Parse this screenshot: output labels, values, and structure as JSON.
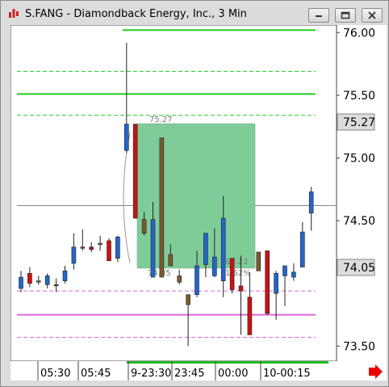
{
  "window": {
    "title": "S.FANG - Diamondback Energy, Inc., 3 Min",
    "buttons": [
      "minimize",
      "restore",
      "close"
    ]
  },
  "colors": {
    "up": "#2266cc",
    "down": "#cc1111",
    "neutral": "#7a5a30",
    "green_line": "#22cc22",
    "pink_line": "#dd66dd",
    "box_fill": "#80cc99",
    "x_axis_bar": "#22bb22",
    "arrow": "#ee0000"
  },
  "price_labels": {
    "current": "75.27",
    "last": "74.05"
  },
  "box_labels": {
    "top": "75.27",
    "bottom": "74.05",
    "amount": "$1.22",
    "percent": "1.62%"
  },
  "chart_data": {
    "type": "candlestick",
    "title": "S.FANG - Diamondback Energy, Inc., 3 Min",
    "y_ticks": [
      "76.00",
      "75.50",
      "75.00",
      "74.50",
      "73.50"
    ],
    "y_tick_values": [
      76.0,
      75.5,
      75.0,
      74.5,
      73.5
    ],
    "ylim": [
      73.38,
      76.06
    ],
    "x_ticks": [
      "05:30",
      "05:45",
      "9-23:30",
      "23:45",
      "00:00",
      "10-00:15"
    ],
    "candles": [
      {
        "o": 74.05,
        "h": 74.1,
        "l": 73.93,
        "c": 73.96,
        "color": "up"
      },
      {
        "o": 74.08,
        "h": 74.13,
        "l": 73.97,
        "c": 74.0,
        "color": "down"
      },
      {
        "o": 74.02,
        "h": 74.06,
        "l": 73.99,
        "c": 74.02,
        "color": "neutral"
      },
      {
        "o": 73.99,
        "h": 74.08,
        "l": 73.96,
        "c": 74.06,
        "color": "up"
      },
      {
        "o": 73.99,
        "h": 74.04,
        "l": 73.93,
        "c": 73.99,
        "color": "neutral"
      },
      {
        "o": 74.02,
        "h": 74.14,
        "l": 74.0,
        "c": 74.1,
        "color": "up"
      },
      {
        "o": 74.16,
        "h": 74.4,
        "l": 74.11,
        "c": 74.29,
        "color": "up"
      },
      {
        "o": 74.29,
        "h": 74.43,
        "l": 74.26,
        "c": 74.29,
        "color": "neutral"
      },
      {
        "o": 74.29,
        "h": 74.33,
        "l": 74.25,
        "c": 74.27,
        "color": "down"
      },
      {
        "o": 74.32,
        "h": 74.38,
        "l": 74.26,
        "c": 74.32,
        "color": "neutral"
      },
      {
        "o": 74.34,
        "h": 74.36,
        "l": 74.18,
        "c": 74.18,
        "color": "down"
      },
      {
        "o": 74.2,
        "h": 74.38,
        "l": 74.17,
        "c": 74.37,
        "color": "up"
      },
      {
        "o": 75.06,
        "h": 75.92,
        "l": 75.04,
        "c": 75.27,
        "color": "up"
      },
      {
        "o": 75.27,
        "h": 75.27,
        "l": 74.52,
        "c": 74.52,
        "color": "down"
      },
      {
        "o": 74.51,
        "h": 74.57,
        "l": 74.38,
        "c": 74.4,
        "color": "neutral"
      },
      {
        "o": 74.51,
        "h": 74.65,
        "l": 74.05,
        "c": 74.05,
        "color": "up"
      },
      {
        "o": 75.16,
        "h": 75.16,
        "l": 74.05,
        "c": 74.05,
        "color": "neutral"
      },
      {
        "o": 74.23,
        "h": 74.31,
        "l": 74.14,
        "c": 74.14,
        "color": "neutral"
      },
      {
        "o": 74.06,
        "h": 74.11,
        "l": 73.99,
        "c": 74.01,
        "color": "neutral"
      },
      {
        "o": 73.91,
        "h": 73.91,
        "l": 73.5,
        "c": 73.83,
        "color": "neutral"
      },
      {
        "o": 73.91,
        "h": 74.26,
        "l": 73.89,
        "c": 74.14,
        "color": "up"
      },
      {
        "o": 74.4,
        "h": 74.4,
        "l": 74.05,
        "c": 74.15,
        "color": "up"
      },
      {
        "o": 74.06,
        "h": 74.44,
        "l": 74.05,
        "c": 74.21,
        "color": "up"
      },
      {
        "o": 74.02,
        "h": 74.7,
        "l": 73.89,
        "c": 74.52,
        "color": "up"
      },
      {
        "o": 74.2,
        "h": 74.2,
        "l": 73.92,
        "c": 73.95,
        "color": "down"
      },
      {
        "o": 73.98,
        "h": 74.22,
        "l": 73.59,
        "c": 73.94,
        "color": "down"
      },
      {
        "o": 73.89,
        "h": 74.09,
        "l": 73.61,
        "c": 73.59,
        "color": "down"
      },
      {
        "o": 74.25,
        "h": 74.25,
        "l": 74.1,
        "c": 74.1,
        "color": "neutral"
      },
      {
        "o": 74.26,
        "h": 74.26,
        "l": 73.75,
        "c": 73.76,
        "color": "down"
      },
      {
        "o": 74.08,
        "h": 74.1,
        "l": 73.71,
        "c": 73.92,
        "color": "up"
      },
      {
        "o": 74.06,
        "h": 74.14,
        "l": 73.82,
        "c": 74.14,
        "color": "up"
      },
      {
        "o": 74.05,
        "h": 74.16,
        "l": 74.02,
        "c": 74.09,
        "color": "up"
      },
      {
        "o": 74.13,
        "h": 74.49,
        "l": 74.13,
        "c": 74.41,
        "color": "up"
      },
      {
        "o": 74.56,
        "h": 74.77,
        "l": 74.42,
        "c": 74.73,
        "color": "up"
      }
    ],
    "horizontal_lines": [
      {
        "value": 76.02,
        "style": "solid",
        "color": "green",
        "from_candle": 12
      },
      {
        "value": 75.69,
        "style": "dashed",
        "color": "green"
      },
      {
        "value": 75.51,
        "style": "solid",
        "color": "green"
      },
      {
        "value": 75.34,
        "style": "dashed",
        "color": "green"
      },
      {
        "value": 74.62,
        "style": "solid",
        "color": "gray"
      },
      {
        "value": 73.94,
        "style": "dashed",
        "color": "pink"
      },
      {
        "value": 73.75,
        "style": "solid",
        "color": "pink"
      },
      {
        "value": 73.57,
        "style": "dashed",
        "color": "pink"
      }
    ]
  }
}
